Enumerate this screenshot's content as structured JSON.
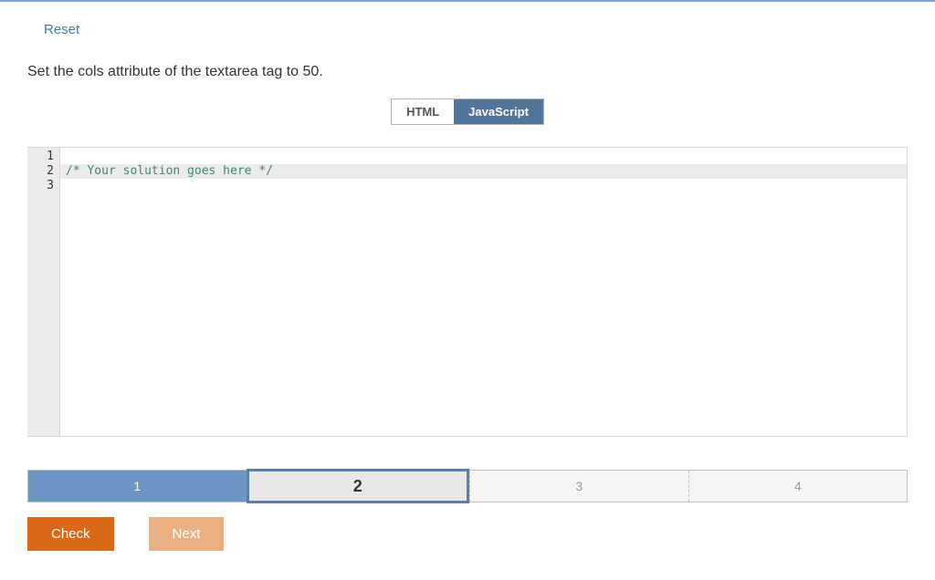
{
  "reset": "Reset",
  "prompt": "Set the cols attribute of the textarea tag to 50.",
  "tabs": {
    "html": "HTML",
    "js": "JavaScript"
  },
  "editor": {
    "line_numbers": [
      "1",
      "2",
      "3"
    ],
    "lines": [
      {
        "text": "",
        "type": "plain"
      },
      {
        "text": "/* Your solution goes here */",
        "type": "comment"
      },
      {
        "text": "",
        "type": "plain"
      }
    ]
  },
  "progress": {
    "segments": [
      {
        "label": "1",
        "state": "completed"
      },
      {
        "label": "2",
        "state": "active"
      },
      {
        "label": "3",
        "state": "inactive"
      },
      {
        "label": "4",
        "state": "inactive"
      }
    ]
  },
  "buttons": {
    "check": "Check",
    "next": "Next"
  }
}
